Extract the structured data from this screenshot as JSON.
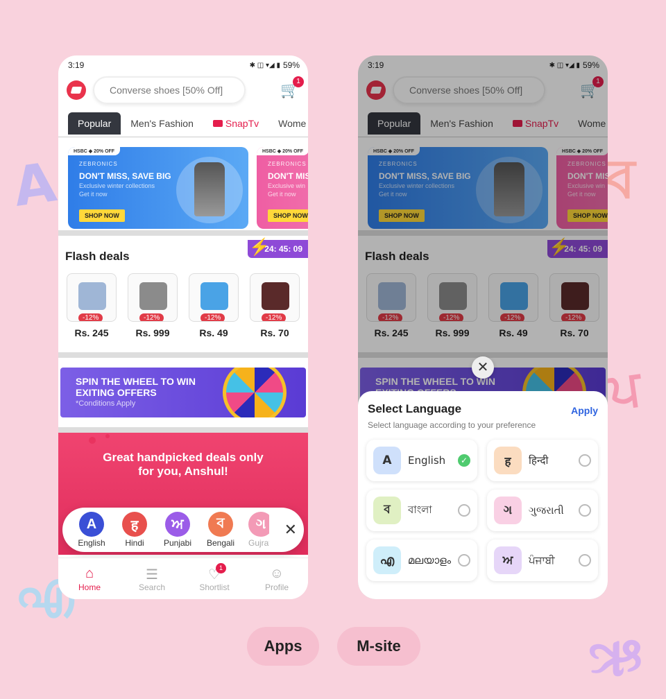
{
  "decor": {
    "a": "A",
    "bn": "ব",
    "ml": "എ",
    "gu": "ઋ",
    "pa": "ਪ"
  },
  "status": {
    "time": "3:19",
    "battery": "59%",
    "icons": "✱ ◫ ▾◢ ▮"
  },
  "search": {
    "placeholder": "Converse shoes [50% Off]"
  },
  "cart": {
    "count": "1"
  },
  "tabs": [
    {
      "label": "Popular"
    },
    {
      "label": "Men's Fashion"
    },
    {
      "label": "SnapTv"
    },
    {
      "label": "Wome"
    }
  ],
  "banners": [
    {
      "tag": "HSBC ◆ 20% OFF",
      "brand": "ZEBRONICS",
      "headline": "DON'T MISS, SAVE BIG",
      "sub1": "Exclusive winter collections",
      "sub2": "Get it now",
      "cta": "SHOP NOW"
    },
    {
      "tag": "HSBC ◆ 20% OFF",
      "brand": "ZEBRONICS",
      "headline": "DON'T MIS",
      "sub1": "Exclusive win",
      "sub2": "Get it now",
      "cta": "SHOP NOW"
    }
  ],
  "flash": {
    "title": "Flash deals",
    "timer": "24: 45: 09",
    "items": [
      {
        "discount": "-12%",
        "price": "Rs. 245",
        "color": "#9fb6d6"
      },
      {
        "discount": "-12%",
        "price": "Rs. 999",
        "color": "#8b8b8b"
      },
      {
        "discount": "-12%",
        "price": "Rs. 49",
        "color": "#4aa3e6"
      },
      {
        "discount": "-12%",
        "price": "Rs. 70",
        "color": "#5a2a2a"
      }
    ]
  },
  "spin": {
    "line1": "SPIN THE WHEEL TO WIN",
    "line2": "EXITING OFFERS",
    "cond": "*Conditions Apply"
  },
  "deals": {
    "line1": "Great handpicked deals only",
    "line2": "for you, Anshul!"
  },
  "langbar": {
    "items": [
      {
        "glyph": "A",
        "name": "English",
        "color": "#3a4fd6"
      },
      {
        "glyph": "ह",
        "name": "Hindi",
        "color": "#e8504d"
      },
      {
        "glyph": "ਅ",
        "name": "Punjabi",
        "color": "#9b5ce8"
      },
      {
        "glyph": "ব",
        "name": "Bengali",
        "color": "#f07a52"
      },
      {
        "glyph": "ગ",
        "name": "Gujrat",
        "color": "#f39ab6"
      }
    ],
    "close": "✕"
  },
  "nav": [
    {
      "label": "Home",
      "icon": "⌂"
    },
    {
      "label": "Search",
      "icon": "☰"
    },
    {
      "label": "Shortlist",
      "icon": "♡",
      "badge": "1"
    },
    {
      "label": "Profile",
      "icon": "☺"
    }
  ],
  "sheet": {
    "close": "✕",
    "title": "Select Language",
    "apply": "Apply",
    "subtitle": "Select language according to your preference",
    "languages": [
      {
        "glyph": "A",
        "name": "English",
        "bg": "#cfe0fb"
      },
      {
        "glyph": "ह",
        "name": "हिन्दी",
        "bg": "#fbdcc0"
      },
      {
        "glyph": "ব",
        "name": "বাংলা",
        "bg": "#e0f0c3"
      },
      {
        "glyph": "ગ",
        "name": "ગુજરાતી",
        "bg": "#f9d0e4"
      },
      {
        "glyph": "എ",
        "name": "മലയാളം",
        "bg": "#cfeefa"
      },
      {
        "glyph": "ਅ",
        "name": "ਪੰਜਾਬੀ",
        "bg": "#e6d6f8"
      }
    ],
    "selected_mark": "✓"
  },
  "labels": {
    "apps": "Apps",
    "msite": "M-site"
  }
}
